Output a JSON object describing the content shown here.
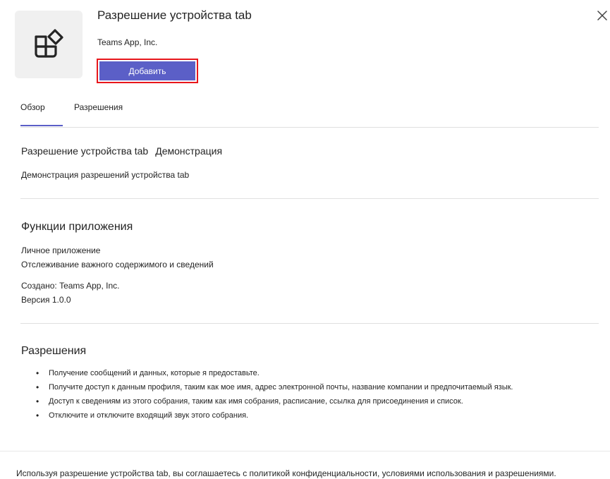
{
  "app": {
    "title": "Разрешение устройства tab",
    "publisher": "Teams App, Inc.",
    "add_label": "Добавить",
    "icon": "app-blocks-icon"
  },
  "tabs": [
    {
      "label": "Обзор",
      "selected": true
    },
    {
      "label": "Разрешения",
      "selected": false
    }
  ],
  "overview": {
    "title": "Разрешение устройства tab",
    "title_suffix": "Демонстрация",
    "description": "Демонстрация разрешений устройства tab"
  },
  "features": {
    "heading": "Функции приложения",
    "lines": [
      "Личное приложение",
      "Отслеживание важного содержимого и сведений",
      "Создано: Teams App, Inc.",
      "Версия 1.0.0"
    ]
  },
  "permissions": {
    "heading": "Разрешения",
    "items": [
      "Получение сообщений и данных, которые я предоставьте.",
      "Получите доступ к данным профиля, таким как мое имя, адрес электронной почты, название компании и предпочитаемый язык.",
      "Доступ к сведениям из этого собрания, таким как имя собрания, расписание, ссылка для присоединения и список.",
      "Отключите и отключите входящий звук этого собрания."
    ]
  },
  "footer": {
    "text": "Используя разрешение устройства tab, вы соглашаетесь с политикой конфиденциальности, условиями использования и разрешениями."
  },
  "colors": {
    "accent": "#5b5fc7",
    "highlight_border": "#e8161b"
  }
}
